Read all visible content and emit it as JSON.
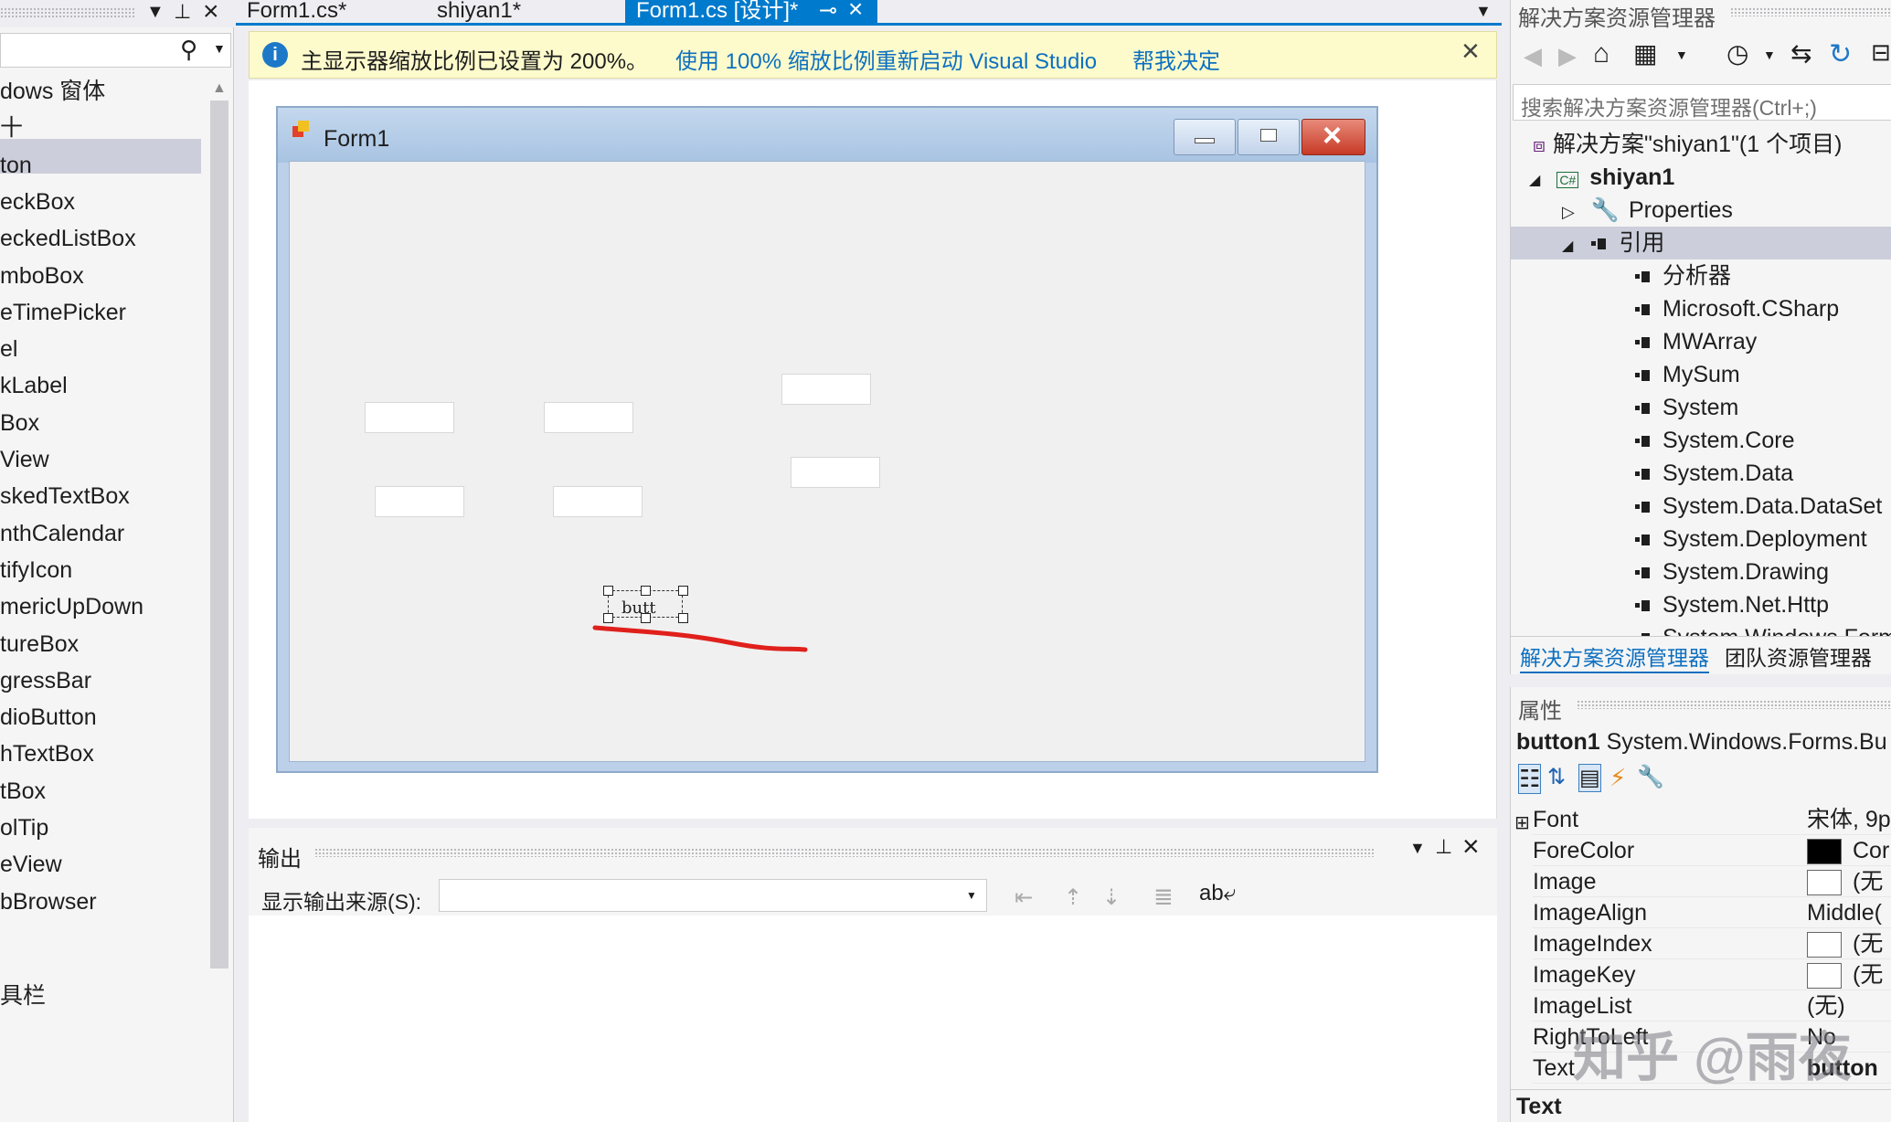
{
  "toolbox": {
    "items": [
      "dows 窗体",
      "十",
      "ton",
      "eckBox",
      "eckedListBox",
      "mboBox",
      "eTimePicker",
      "el",
      "kLabel",
      "Box",
      "View",
      "skedTextBox",
      "nthCalendar",
      "tifyIcon",
      "mericUpDown",
      "tureBox",
      "gressBar",
      "dioButton",
      "hTextBox",
      "tBox",
      "olTip",
      "eView",
      "bBrowser",
      "具栏"
    ]
  },
  "tabs": [
    {
      "label": "Form1.cs*"
    },
    {
      "label": "shiyan1*"
    },
    {
      "label": "Form1.cs [设计]*"
    }
  ],
  "infobar": {
    "message": "主显示器缩放比例已设置为 200%。",
    "link1": "使用 100% 缩放比例重新启动 Visual Studio",
    "link2": "帮我决定"
  },
  "form": {
    "title": "Form1",
    "button_text": "butt"
  },
  "output": {
    "title": "输出",
    "source_label": "显示输出来源(S):",
    "source_value": ""
  },
  "solution_explorer": {
    "title": "解决方案资源管理器",
    "search_placeholder": "搜索解决方案资源管理器(Ctrl+;)",
    "solution": "解决方案\"shiyan1\"(1 个项目)",
    "project": "shiyan1",
    "properties": "Properties",
    "references": "引用",
    "items": [
      "分析器",
      "Microsoft.CSharp",
      "MWArray",
      "MySum",
      "System",
      "System.Core",
      "System.Data",
      "System.Data.DataSet",
      "System.Deployment",
      "System.Drawing",
      "System.Net.Http",
      "System.Windows.Form"
    ],
    "tab1": "解决方案资源管理器",
    "tab2": "团队资源管理器"
  },
  "properties": {
    "title": "属性",
    "object": "button1",
    "object_type": "System.Windows.Forms.Bu",
    "rows": [
      {
        "name": "Font",
        "value": "宋体, 9p"
      },
      {
        "name": "ForeColor",
        "value": "Cor"
      },
      {
        "name": "Image",
        "value": "(无"
      },
      {
        "name": "ImageAlign",
        "value": "Middle("
      },
      {
        "name": "ImageIndex",
        "value": "(无"
      },
      {
        "name": "ImageKey",
        "value": "(无"
      },
      {
        "name": "ImageList",
        "value": "(无)"
      },
      {
        "name": "RightToLeft",
        "value": "No"
      },
      {
        "name": "Text",
        "value": "button"
      }
    ],
    "desc_title": "Text",
    "watermark": "知乎 @雨夜"
  },
  "colors": {
    "accent": "#007acc",
    "infobar": "#fdfbcc",
    "close_red": "#c94030"
  }
}
